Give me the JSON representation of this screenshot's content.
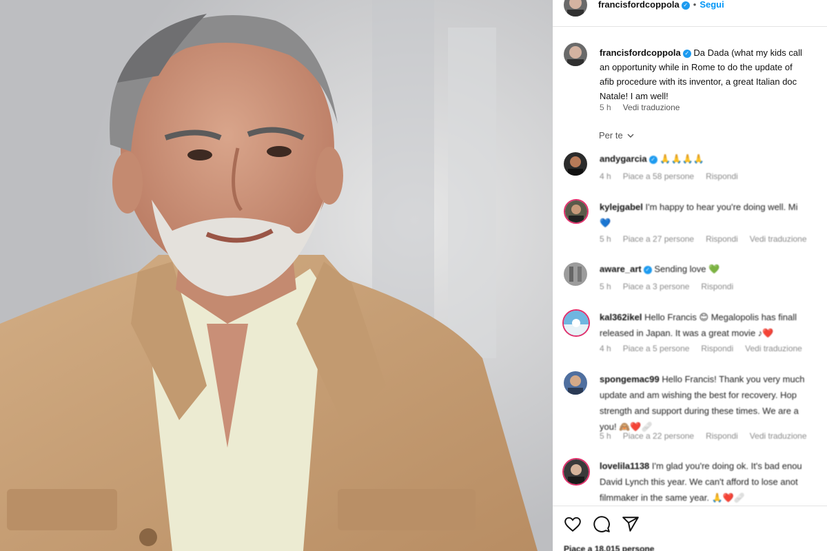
{
  "post": {
    "username": "francisfordcoppola",
    "separator": "•",
    "follow_label": "Segui",
    "caption_lines": [
      "Da Dada (what my kids call",
      "an opportunity while in Rome to do the update of",
      "afib procedure with its inventor, a great Italian doc",
      "Natale! I am well!"
    ],
    "time": "5 h",
    "translate_label": "Vedi traduzione",
    "sort_label": "Per te",
    "likes": "Piace a 18.015 persone"
  },
  "comments": [
    {
      "user": "andygarcia",
      "verified": true,
      "lines": [
        "🙏🙏🙏🙏"
      ],
      "time": "4 h",
      "likes": "Piace a 58 persone",
      "reply": "Rispondi",
      "translate": ""
    },
    {
      "user": "kylejgabel",
      "verified": false,
      "lines": [
        "I'm happy to hear you're doing well. Mi",
        "💙"
      ],
      "time": "5 h",
      "likes": "Piace a 27 persone",
      "reply": "Rispondi",
      "translate": "Vedi traduzione"
    },
    {
      "user": "aware_art",
      "verified": true,
      "lines": [
        "Sending love 💚"
      ],
      "time": "5 h",
      "likes": "Piace a 3 persone",
      "reply": "Rispondi",
      "translate": ""
    },
    {
      "user": "kal362ikel",
      "verified": false,
      "lines": [
        "Hello Francis 😊 Megalopolis has finall",
        "released in Japan. It was a great movie ♪❤️"
      ],
      "time": "4 h",
      "likes": "Piace a 5 persone",
      "reply": "Rispondi",
      "translate": "Vedi traduzione"
    },
    {
      "user": "spongemac99",
      "verified": false,
      "lines": [
        "Hello Francis! Thank you very much",
        "update and am wishing the best for recovery. Hop",
        "strength and support during these times. We are a",
        "you! 🙈❤️🩹"
      ],
      "time": "5 h",
      "likes": "Piace a 22 persone",
      "reply": "Rispondi",
      "translate": "Vedi traduzione"
    },
    {
      "user": "lovelila1138",
      "verified": false,
      "lines": [
        "I'm glad you're doing ok. It's bad enou",
        "David Lynch this year. We can't afford to lose anot",
        "filmmaker in the same year. 🙏❤️🩹"
      ],
      "time": "",
      "likes": "",
      "reply": "",
      "translate": ""
    }
  ],
  "icons": {
    "like": "heart-icon",
    "comment": "comment-icon",
    "share": "share-icon",
    "verified": "verified-badge-icon",
    "chevron": "chevron-down-icon"
  },
  "colors": {
    "follow": "#0095f6",
    "verified": "#1d9bf0",
    "jacket": "#c9a57d",
    "shirt": "#ecebd2"
  }
}
